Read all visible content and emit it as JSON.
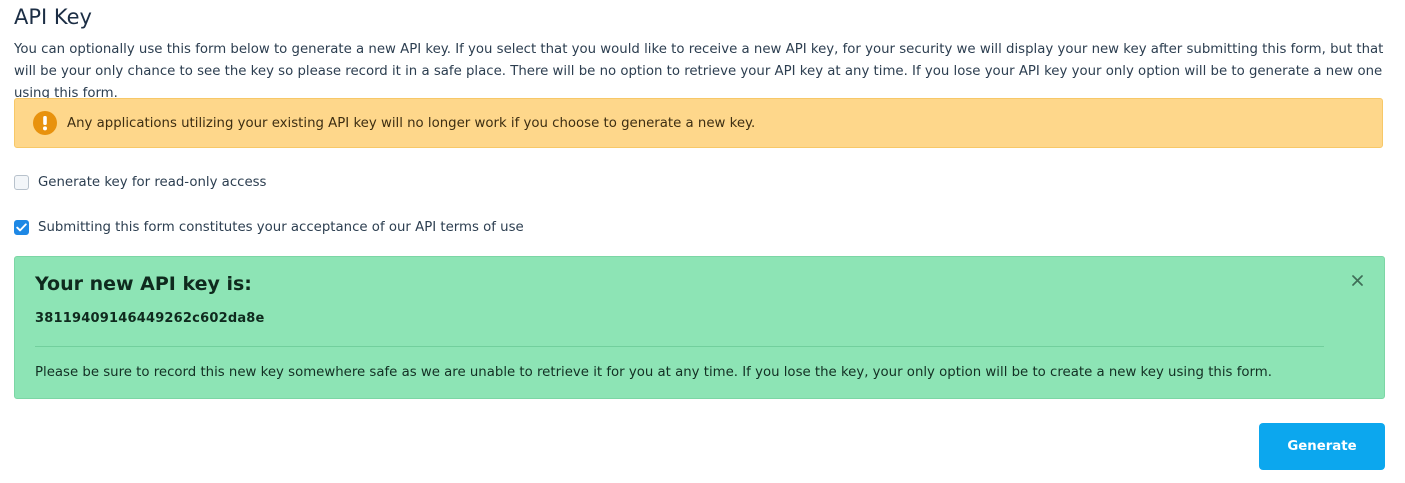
{
  "page": {
    "title": "API Key",
    "intro": "You can optionally use this form below to generate a new API key. If you select that you would like to receive a new API key, for your security we will display your new key after submitting this form, but that will be your only chance to see the key so please record it in a safe place. There will be no option to retrieve your API key at any time. If you lose your API key your only option will be to generate a new one using this form."
  },
  "warning": {
    "icon": "exclamation-icon",
    "text": "Any applications utilizing your existing API key will no longer work if you choose to generate a new key.",
    "background": "#fed78b",
    "icon_color": "#e8920e"
  },
  "options": {
    "read_only": {
      "label": "Generate key for read-only access",
      "checked": false
    },
    "terms": {
      "label": "Submitting this form constitutes your acceptance of our API terms of use",
      "checked": true
    }
  },
  "result": {
    "title": "Your new API key is:",
    "api_key": "38119409146449262c602da8e",
    "note": "Please be sure to record this new key somewhere safe as we are unable to retrieve it for you at any time. If you lose the key, your only option will be to create a new key using this form.",
    "close_icon": "close-icon",
    "background": "#8de4b5"
  },
  "actions": {
    "generate_label": "Generate",
    "accent": "#0ca7ee"
  }
}
